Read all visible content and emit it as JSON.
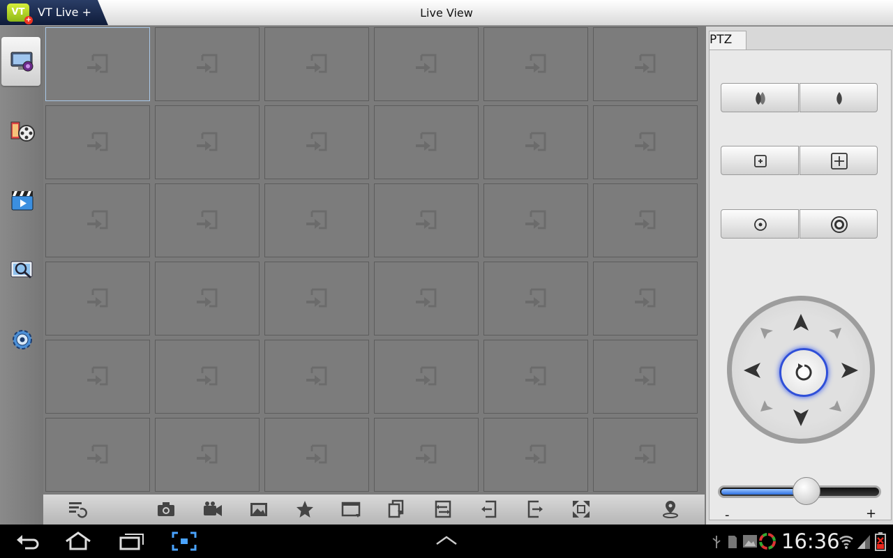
{
  "app": {
    "logo_text": "VT",
    "name": "VT Live +",
    "page_title": "Live View"
  },
  "left_nav": {
    "items": [
      {
        "icon": "live-view-monitor-icon",
        "active": true
      },
      {
        "icon": "playback-film-reel-icon",
        "active": false
      },
      {
        "icon": "video-clapboard-icon",
        "active": false
      },
      {
        "icon": "device-search-icon",
        "active": false
      },
      {
        "icon": "settings-gear-icon",
        "active": false
      }
    ]
  },
  "grid": {
    "rows": 6,
    "columns": 6,
    "selected_cell": 0,
    "placeholder_icon": "add-channel-icon"
  },
  "toolbar": {
    "items": [
      "channel-list-icon",
      "snapshot-camera-icon",
      "record-video-icon",
      "gallery-icon",
      "favorite-star-icon",
      "window-layout-icon",
      "previous-group-icon",
      "switch-stream-icon",
      "page-back-icon",
      "page-forward-icon",
      "fullscreen-icon",
      "location-pin-icon"
    ]
  },
  "ptz": {
    "tab_label": "PTZ",
    "focus": {
      "left_icon": "focus-near-icon",
      "right_icon": "focus-far-icon"
    },
    "zoom": {
      "left_icon": "zoom-out-icon",
      "right_icon": "zoom-in-icon"
    },
    "iris": {
      "left_icon": "iris-close-icon",
      "right_icon": "iris-open-icon"
    },
    "speed_slider": {
      "value": 0.49,
      "min_label": "-",
      "max_label": "+"
    }
  },
  "system_bar": {
    "time": "16:36",
    "colors": {
      "battery_warning": "#e8281e",
      "accent": "#2f4fd8"
    }
  }
}
